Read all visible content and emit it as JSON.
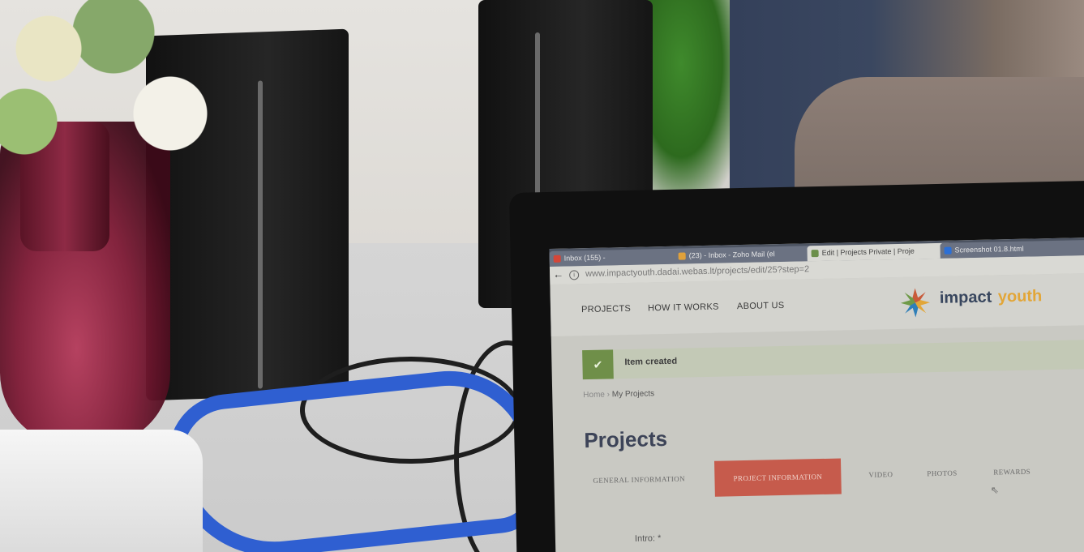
{
  "browser": {
    "tabs": [
      {
        "label": "Inbox (155) - ",
        "icon_color": "#d44638",
        "active": false
      },
      {
        "label": "(23) - Inbox - Zoho Mail (el",
        "icon_color": "#e0a13b",
        "active": false
      },
      {
        "label": "Edit | Projects Private | Proje",
        "icon_color": "#6b8f4a",
        "active": true
      },
      {
        "label": "Screenshot 01.8.html",
        "icon_color": "#2b6fd6",
        "active": false
      }
    ],
    "tab_close_glyph": "×",
    "back_glyph": "←",
    "info_glyph": "i",
    "url": "www.impactyouth.dadai.webas.lt/projects/edit/25?step=2"
  },
  "site": {
    "nav": [
      "PROJECTS",
      "HOW IT WORKS",
      "ABOUT US"
    ],
    "logo_word_1": "impact",
    "logo_word_2": "youth",
    "logo_colors": [
      "#c85a3a",
      "#e2a638",
      "#2f7fb8",
      "#6f9a48"
    ],
    "flash_icon": "✔",
    "flash_message": "Item created",
    "breadcrumb": {
      "home": "Home",
      "separator": "›",
      "current": "My Projects"
    },
    "page_title": "Projects",
    "form_tabs": [
      {
        "label": "GENERAL INFORMATION",
        "active": false
      },
      {
        "label": "PROJECT INFORMATION",
        "active": true
      },
      {
        "label": "VIDEO",
        "active": false
      },
      {
        "label": "PHOTOS",
        "active": false
      },
      {
        "label": "REWARDS",
        "active": false
      }
    ],
    "cursor_glyph": "⇖",
    "first_field_label": "Intro: *"
  }
}
